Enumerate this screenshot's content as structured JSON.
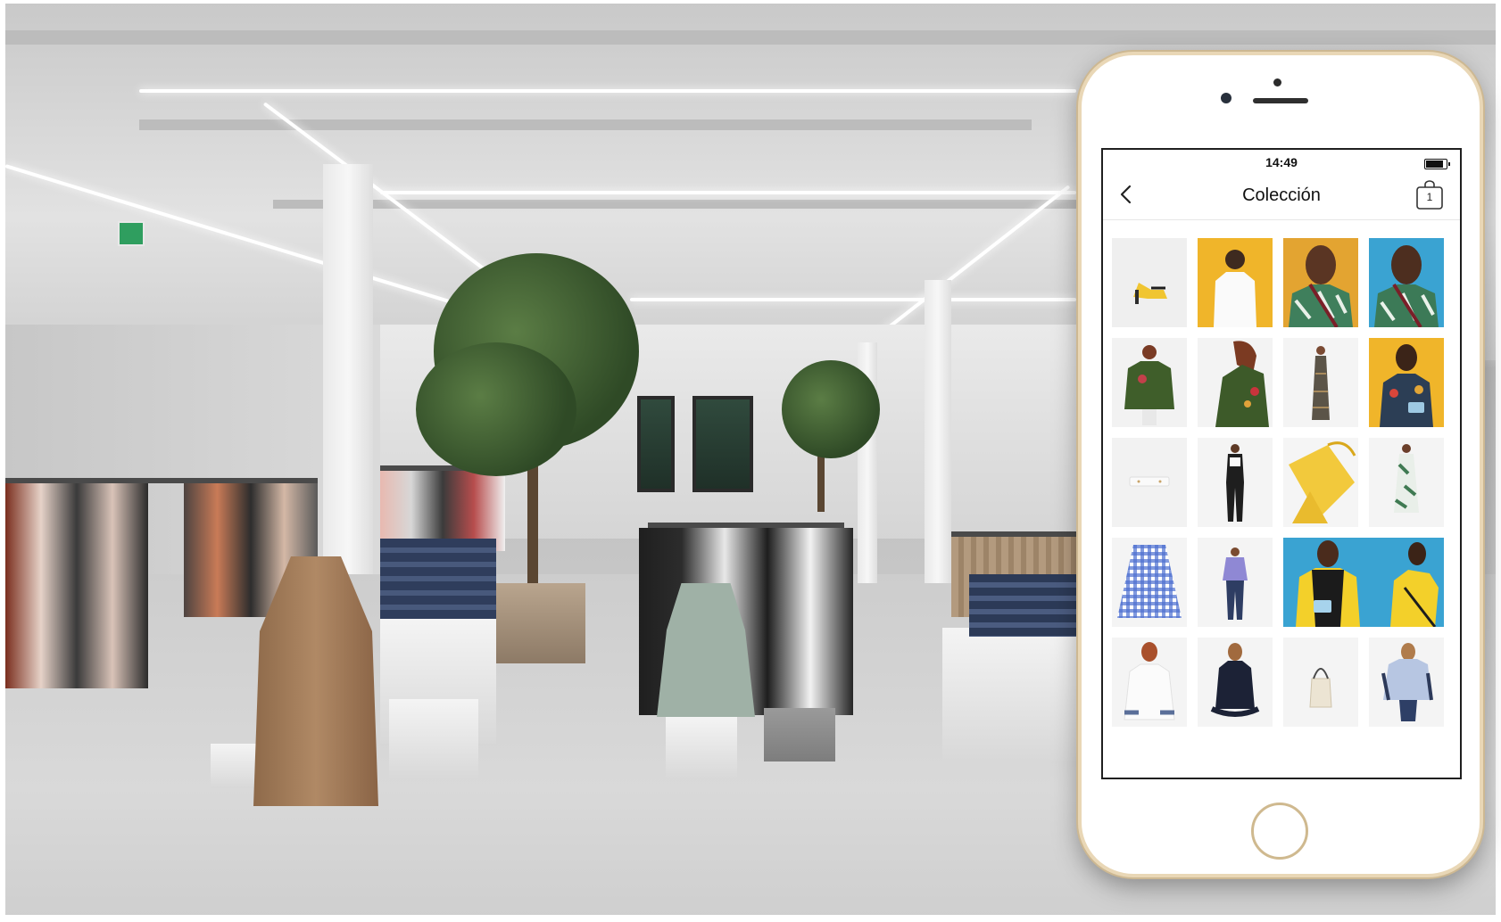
{
  "screen": {
    "status_bar": {
      "time": "14:49"
    },
    "nav": {
      "title": "Colección",
      "cart_count": "1"
    }
  },
  "colors": {
    "phone_frame": "#e9d7b6",
    "mustard": "#f0b52a",
    "sky_blue": "#3aa3d2"
  },
  "icons": {
    "back": "chevron-left-icon",
    "cart": "shopping-bag-icon",
    "battery": "battery-icon"
  },
  "collection_tiles": [
    {
      "name": "yellow-heeled-mule"
    },
    {
      "name": "white-tee-model-yellow"
    },
    {
      "name": "tropical-print-top-model-a"
    },
    {
      "name": "tropical-print-top-model-b"
    },
    {
      "name": "green-embroidered-bomber"
    },
    {
      "name": "green-embroidered-jacket-closeup"
    },
    {
      "name": "long-print-dress"
    },
    {
      "name": "floral-dress-with-bag"
    },
    {
      "name": "white-belt"
    },
    {
      "name": "black-jumpsuit"
    },
    {
      "name": "yellow-tote-bag"
    },
    {
      "name": "green-print-dress"
    },
    {
      "name": "blue-gingham-skirt"
    },
    {
      "name": "lilac-shirt-and-jeans"
    },
    {
      "name": "black-vest-yellow-shirt-models"
    },
    {
      "name": "white-embroidered-blouse"
    },
    {
      "name": "black-ruffle-top"
    },
    {
      "name": "cream-bucket-bag"
    },
    {
      "name": "lace-trim-blouse"
    }
  ]
}
